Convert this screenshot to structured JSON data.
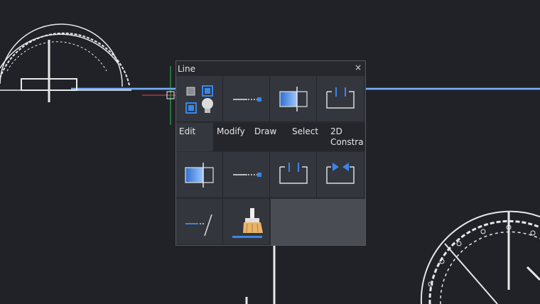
{
  "panel": {
    "title": "Line",
    "close_label": "×",
    "tabs": [
      {
        "label": "Edit",
        "active": true
      },
      {
        "label": "Modify",
        "active": false
      },
      {
        "label": "Draw",
        "active": false
      },
      {
        "label": "Select",
        "active": false
      },
      {
        "label": "2D Constra",
        "active": false
      }
    ],
    "tools_row1": [
      "layer-visibility-icon",
      "line-extend-icon",
      "gradient-split-icon",
      "bracket-measure-icon"
    ],
    "tools_row2": [
      "gradient-split-icon",
      "line-extend-icon",
      "bracket-measure-icon",
      "arrows-in-bracket-icon"
    ],
    "tools_row3": [
      "line-break-icon",
      "brush-icon"
    ]
  },
  "colors": {
    "background": "#202228",
    "accent_blue": "#3a86e8",
    "panel": "#33363c"
  }
}
